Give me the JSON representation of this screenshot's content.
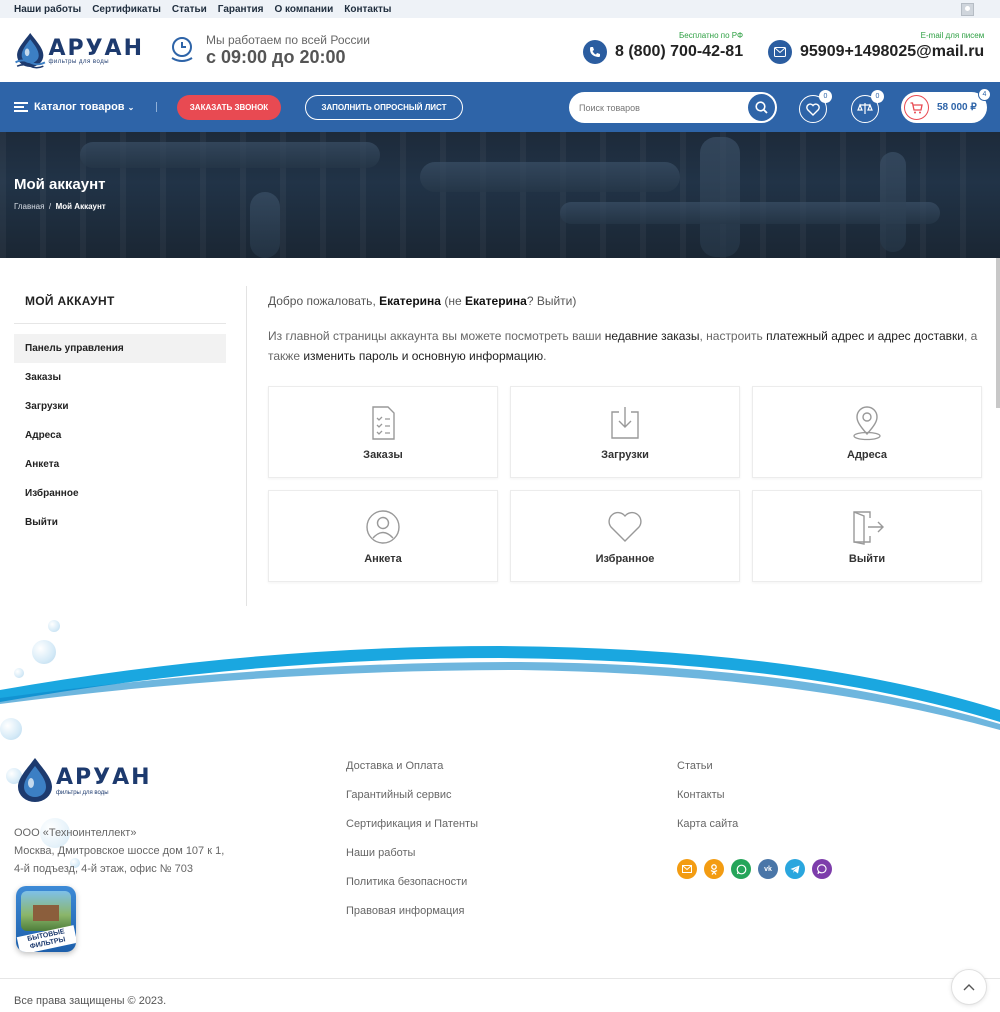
{
  "topbar": {
    "links": [
      "Наши работы",
      "Сертификаты",
      "Статьи",
      "Гарантия",
      "О компании",
      "Контакты"
    ]
  },
  "header": {
    "logo_name": "АРУАН",
    "logo_tagline": "фильтры для воды",
    "worktime_label": "Мы работаем по всей России",
    "worktime_hours": "с 09:00 до 20:00",
    "phone_note": "Бесплатно по РФ",
    "phone": "8 (800) 700-42-81",
    "email_note": "E-mail для писем",
    "email": "95909+1498025@mail.ru"
  },
  "nav": {
    "catalog_label": "Каталог товаров",
    "call_button": "ЗАКАЗАТЬ ЗВОНОК",
    "form_button": "ЗАПОЛНИТЬ ОПРОСНЫЙ ЛИСТ",
    "search_placeholder": "Поиск товаров",
    "wishlist_count": "0",
    "compare_count": "0",
    "cart_amount": "58 000 ₽",
    "cart_count": "4"
  },
  "hero": {
    "title": "Мой аккаунт",
    "crumb_home": "Главная",
    "crumb_sep": "/",
    "crumb_current": "Мой Аккаунт"
  },
  "sidebar": {
    "title": "МОЙ АККАУНТ",
    "items": [
      {
        "label": "Панель управления"
      },
      {
        "label": "Заказы"
      },
      {
        "label": "Загрузки"
      },
      {
        "label": "Адреса"
      },
      {
        "label": "Анкета"
      },
      {
        "label": "Избранное"
      },
      {
        "label": "Выйти"
      }
    ]
  },
  "content": {
    "welcome_prefix": "Добро пожаловать, ",
    "user_name": "Екатерина",
    "welcome_middle": " (не ",
    "user_name2": "Екатерина",
    "welcome_logout": "? Выйти)",
    "intro_1": "Из главной страницы аккаунта вы можете посмотреть ваши ",
    "intro_link1": "недавние заказы",
    "intro_2": ", настроить ",
    "intro_link2": "платежный адрес и адрес доставки",
    "intro_3": ", а также ",
    "intro_link3": "изменить пароль и основную информацию",
    "intro_4": ".",
    "cards": [
      {
        "label": "Заказы",
        "icon": "orders-icon"
      },
      {
        "label": "Загрузки",
        "icon": "downloads-icon"
      },
      {
        "label": "Адреса",
        "icon": "address-icon"
      },
      {
        "label": "Анкета",
        "icon": "profile-icon"
      },
      {
        "label": "Избранное",
        "icon": "heart-icon"
      },
      {
        "label": "Выйти",
        "icon": "logout-icon"
      }
    ]
  },
  "footer": {
    "company": "ООО «Техноинтеллект»",
    "address_1": "Москва, Дмитровское шоссе дом 107 к 1,",
    "address_2": "4-й подъезд, 4-й этаж, офис № 703",
    "col1": [
      "Доставка и Оплата",
      "Гарантийный сервис",
      "Сертификация и Патенты",
      "Наши работы",
      "Политика безопасности",
      "Правовая информация"
    ],
    "col2": [
      "Статьи",
      "Контакты",
      "Карта сайта"
    ],
    "badge_text": "БЫТОВЫЕ ФИЛЬТРЫ",
    "copyright": "Все права защищены © 2023.",
    "social_colors": [
      "#f39c12",
      "#f39c12",
      "#25a55a",
      "#4a76a8",
      "#2aa6de",
      "#7d3dab"
    ]
  }
}
